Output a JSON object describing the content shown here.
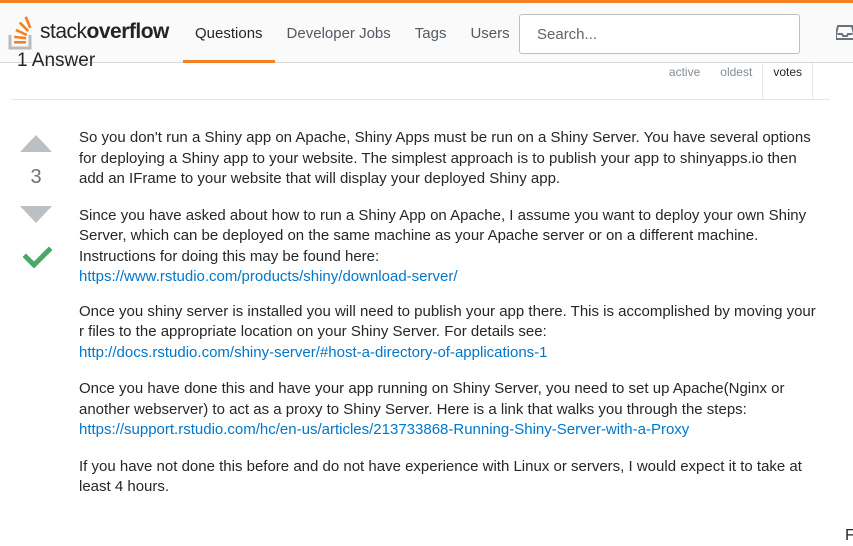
{
  "brand": {
    "light": "stack",
    "bold": "overflow"
  },
  "nav": [
    "Questions",
    "Developer Jobs",
    "Tags",
    "Users"
  ],
  "search": {
    "placeholder": "Search..."
  },
  "answers": {
    "count_label": "1 Answer",
    "sort_tabs": [
      "active",
      "oldest",
      "votes"
    ],
    "selected_tab": "votes"
  },
  "answer": {
    "score": "3",
    "accepted": true,
    "paragraphs": [
      {
        "text": "So you don't run a Shiny app on Apache, Shiny Apps must be run on a Shiny Server. You have several options for deploying a Shiny app to your website. The simplest approach is to publish your app to shinyapps.io then add an IFrame to your website that will display your deployed Shiny app."
      },
      {
        "text": "Since you have asked about how to run a Shiny App on Apache, I assume you want to deploy your own Shiny Server, which can be deployed on the same machine as your Apache server or on a different machine. Instructions for doing this may be found here:",
        "link": "https://www.rstudio.com/products/shiny/download-server/"
      },
      {
        "text": "Once you shiny server is installed you will need to publish your app there. This is accomplished by moving your r files to the appropriate location on your Shiny Server. For details see:",
        "link": "http://docs.rstudio.com/shiny-server/#host-a-directory-of-applications-1"
      },
      {
        "text": "Once you have done this and have your app running on Shiny Server, you need to set up Apache(Nginx or another webserver) to act as a proxy to Shiny Server. Here is a link that walks you through the steps:",
        "link": "https://support.rstudio.com/hc/en-us/articles/213733868-Running-Shiny-Server-with-a-Proxy"
      },
      {
        "text": "If you have not done this before and do not have experience with Linux or servers, I would expect it to take at least 4 hours."
      }
    ]
  },
  "edge_text": "F",
  "colors": {
    "accent": "#f48024",
    "link": "#0077cc",
    "accepted": "#48a868",
    "vote_arrow": "#bbc0c4"
  }
}
